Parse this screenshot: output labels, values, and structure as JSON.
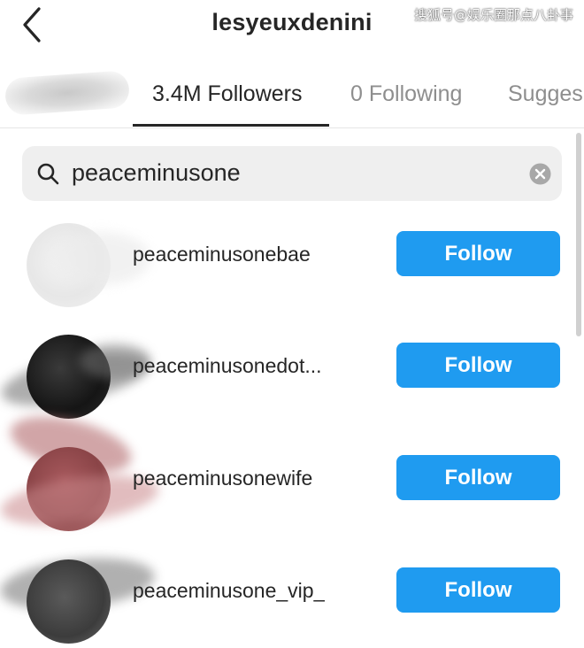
{
  "header": {
    "title": "lesyeuxdenini",
    "watermark": "搜狐号@娱乐圈那点八卦事",
    "back_icon": "chevron-left-icon"
  },
  "tabs": [
    {
      "label": "3.4M Followers",
      "active": true
    },
    {
      "label": "0 Following",
      "active": false
    },
    {
      "label": "Sugges",
      "active": false
    }
  ],
  "search": {
    "value": "peaceminusone",
    "icon": "search-icon",
    "clear_icon": "clear-icon"
  },
  "results": [
    {
      "username": "peaceminusonebae",
      "button": "Follow"
    },
    {
      "username": "peaceminusonedot...",
      "button": "Follow"
    },
    {
      "username": "peaceminusonewife",
      "button": "Follow"
    },
    {
      "username": "peaceminusone_vip_",
      "button": "Follow"
    }
  ],
  "colors": {
    "follow_button": "#1f9bf0",
    "text": "#262626",
    "muted": "#8e8e8e",
    "search_bg": "#efefef"
  }
}
